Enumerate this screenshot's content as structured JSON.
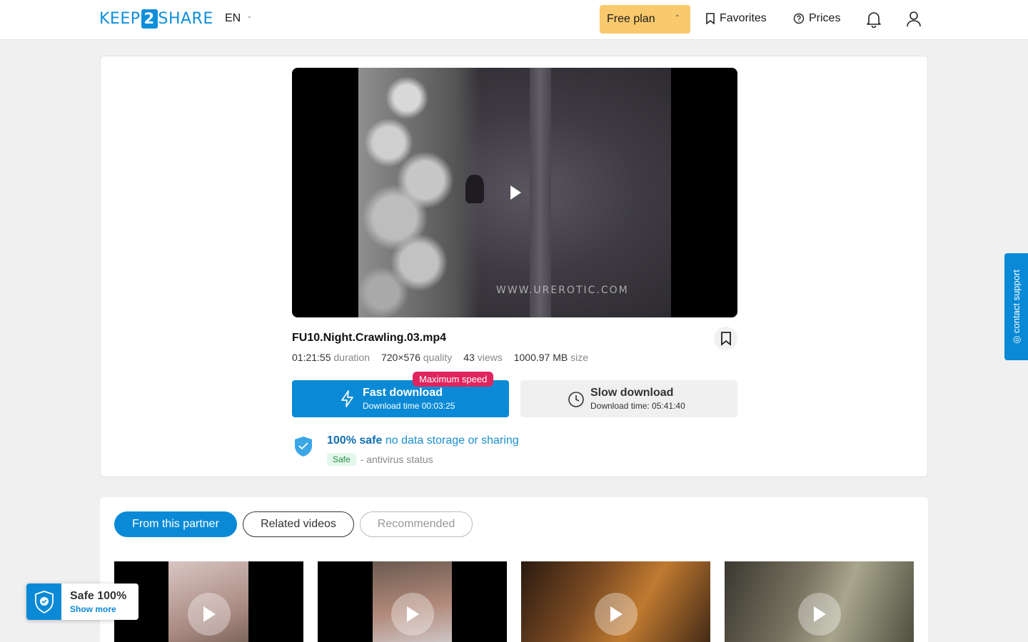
{
  "header": {
    "logo": {
      "left": "KEEP",
      "mid": "2",
      "right": "SHARE"
    },
    "language": "EN",
    "plan": "Free plan",
    "favorites": "Favorites",
    "prices": "Prices"
  },
  "video": {
    "watermark": "WWW.UREROTIC.COM",
    "filename": "FU10.Night.Crawling.03.mp4",
    "duration": "01:21:55",
    "duration_label": "duration",
    "quality": "720×576",
    "quality_label": "quality",
    "views": "43",
    "views_label": "views",
    "size": "1000.97 MB",
    "size_label": "size"
  },
  "download": {
    "fast_title": "Fast download",
    "fast_time": "Download time 00:03:25",
    "badge": "Maximum speed",
    "slow_title": "Slow download",
    "slow_time": "Download time: 05:41:40"
  },
  "safety": {
    "headline": "100% safe",
    "subline": "no data storage or sharing",
    "status_chip": "Safe",
    "status_text": "- antivirus status"
  },
  "tabs": [
    "From this partner",
    "Related videos",
    "Recommended"
  ],
  "widget": {
    "title": "Safe 100%",
    "link": "Show more"
  },
  "contact": "contact support",
  "colors": {
    "accent": "#0a8ad6",
    "plan": "#f9c96d",
    "badge": "#e0245e"
  }
}
